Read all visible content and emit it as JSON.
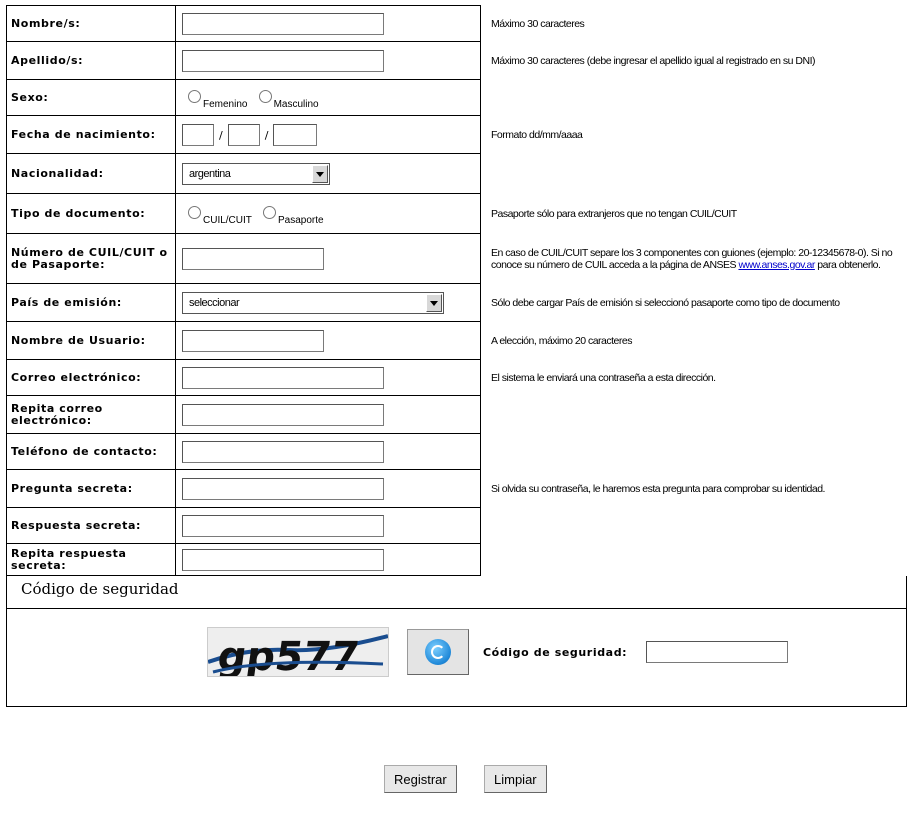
{
  "fields": {
    "nombres": {
      "label": "Nombre/s:",
      "hint": "Máximo 30 caracteres",
      "value": ""
    },
    "apellidos": {
      "label": "Apellido/s:",
      "hint": "Máximo 30 caracteres (debe ingresar el apellido igual al registrado en su DNI)",
      "value": ""
    },
    "sexo": {
      "label": "Sexo:",
      "opt1": "Femenino",
      "opt2": "Masculino"
    },
    "fecha": {
      "label": "Fecha de nacimiento:",
      "sep": "/",
      "hint": "Formato dd/mm/aaaa"
    },
    "nacionalidad": {
      "label": "Nacionalidad:",
      "selected": "argentina"
    },
    "tipo_doc": {
      "label": "Tipo de documento:",
      "opt1": "CUIL/CUIT",
      "opt2": "Pasaporte",
      "hint": "Pasaporte sólo para extranjeros que no tengan CUIL/CUIT"
    },
    "numero": {
      "label": "Número de CUIL/CUIT o de Pasaporte:",
      "hint": "En caso de CUIL/CUIT separe los 3 componentes con guiones (ejemplo: 20-12345678-0). Si no conoce su número de CUIL acceda a la página de ANSES",
      "link": "www.anses.gov.ar",
      "hint_tail": " para obtenerlo."
    },
    "pais": {
      "label": "País de emisión:",
      "selected": "seleccionar",
      "hint": "Sólo debe cargar País de emisión si seleccionó pasaporte como tipo de documento"
    },
    "usuario": {
      "label": "Nombre de Usuario:",
      "hint": "A elección, máximo 20 caracteres"
    },
    "correo": {
      "label": "Correo electrónico:",
      "hint": "El sistema le enviará una contraseña a esta dirección."
    },
    "correo2": {
      "label": "Repita correo electrónico:"
    },
    "telefono": {
      "label": "Teléfono de contacto:"
    },
    "pregunta": {
      "label": "Pregunta secreta:",
      "hint": "Si olvida su contraseña, le haremos esta pregunta para comprobar su identidad."
    },
    "respuesta": {
      "label": "Respuesta secreta:"
    },
    "respuesta2": {
      "label": "Repita respuesta secreta:"
    }
  },
  "captcha": {
    "section_title": "Código de seguridad",
    "image_text": "gp577",
    "field_label": "Código de seguridad:",
    "refresh_icon": "refresh-icon"
  },
  "buttons": {
    "register": "Registrar",
    "clear": "Limpiar"
  }
}
